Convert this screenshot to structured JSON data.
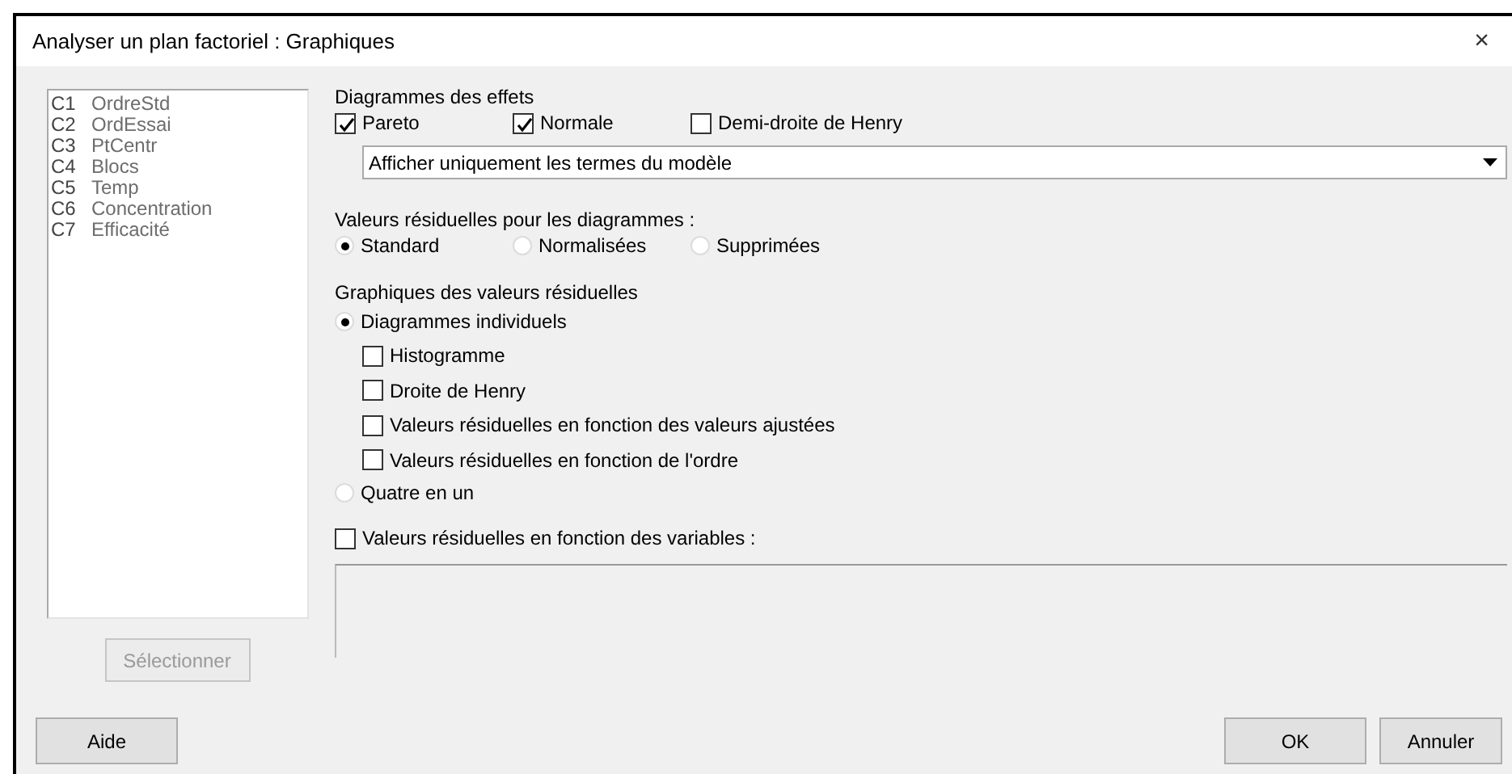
{
  "window": {
    "title": "Analyser un plan factoriel : Graphiques",
    "close": "×"
  },
  "columns": [
    {
      "id": "C1",
      "name": "OrdreStd"
    },
    {
      "id": "C2",
      "name": "OrdEssai"
    },
    {
      "id": "C3",
      "name": "PtCentr"
    },
    {
      "id": "C4",
      "name": "Blocs"
    },
    {
      "id": "C5",
      "name": "Temp"
    },
    {
      "id": "C6",
      "name": "Concentration"
    },
    {
      "id": "C7",
      "name": "Efficacité"
    }
  ],
  "select_button": {
    "label": "Sélectionner",
    "disabled": true
  },
  "effects": {
    "heading": "Diagrammes des effets",
    "checkboxes": [
      {
        "label": "Pareto",
        "checked": true
      },
      {
        "label": "Normale",
        "checked": true
      },
      {
        "label": "Demi-droite de Henry",
        "checked": false
      }
    ],
    "dropdown": {
      "value": "Afficher uniquement les termes du modèle"
    }
  },
  "residual_type": {
    "heading": "Valeurs résiduelles pour les diagrammes :",
    "options": [
      {
        "label": "Standard",
        "selected": true
      },
      {
        "label": "Normalisées",
        "selected": false
      },
      {
        "label": "Supprimées",
        "selected": false
      }
    ]
  },
  "residual_plots": {
    "heading": "Graphiques des valeurs résiduelles",
    "options": [
      {
        "label": "Diagrammes individuels",
        "selected": true,
        "children": [
          {
            "label": "Histogramme",
            "checked": false
          },
          {
            "label": "Droite de Henry",
            "checked": false
          },
          {
            "label": "Valeurs résiduelles en fonction des valeurs ajustées",
            "checked": false
          },
          {
            "label": "Valeurs résiduelles en fonction de l'ordre",
            "checked": false
          }
        ]
      },
      {
        "label": "Quatre en un",
        "selected": false
      }
    ]
  },
  "variables": {
    "label": "Valeurs résiduelles en fonction des variables :",
    "checked": false
  },
  "buttons_left": [
    "Aide"
  ],
  "buttons_right": [
    "OK",
    "Annuler"
  ]
}
